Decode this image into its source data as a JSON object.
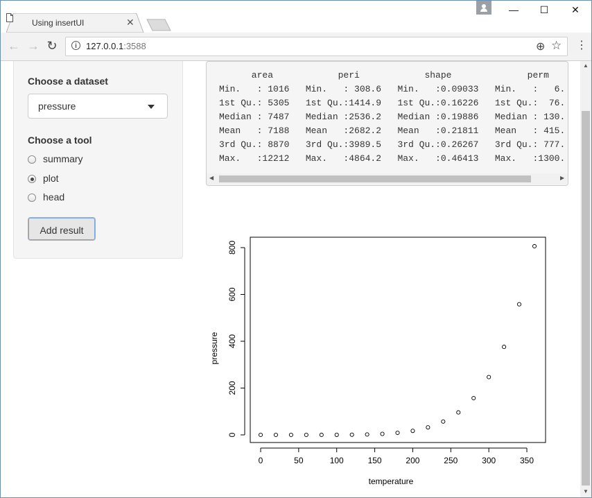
{
  "browser": {
    "tab_title": "Using insertUI",
    "url_host": "127.0.0.1",
    "url_port": ":3588"
  },
  "sidebar": {
    "dataset_label": "Choose a dataset",
    "dataset_value": "pressure",
    "tool_label": "Choose a tool",
    "tools": [
      {
        "label": "summary",
        "checked": false
      },
      {
        "label": "plot",
        "checked": true
      },
      {
        "label": "head",
        "checked": false
      }
    ],
    "add_button": "Add result"
  },
  "summary": {
    "lines": [
      "      area            peri            shape              perm",
      "Min.   : 1016   Min.   : 308.6   Min.   :0.09033   Min.   :   6.",
      "1st Qu.: 5305   1st Qu.:1414.9   1st Qu.:0.16226   1st Qu.:  76.",
      "Median : 7487   Median :2536.2   Median :0.19886   Median : 130.",
      "Mean   : 7188   Mean   :2682.2   Mean   :0.21811   Mean   : 415.",
      "3rd Qu.: 8870   3rd Qu.:3989.5   3rd Qu.:0.26267   3rd Qu.: 777.",
      "Max.   :12212   Max.   :4864.2   Max.   :0.46413   Max.   :1300."
    ]
  },
  "chart_data": {
    "type": "scatter",
    "title": "",
    "xlabel": "temperature",
    "ylabel": "pressure",
    "xlim": [
      0,
      360
    ],
    "ylim": [
      0,
      806
    ],
    "xticks": [
      0,
      50,
      100,
      150,
      200,
      250,
      300,
      350
    ],
    "yticks": [
      0,
      200,
      400,
      600,
      800
    ],
    "x": [
      0,
      20,
      40,
      60,
      80,
      100,
      120,
      140,
      160,
      180,
      200,
      220,
      240,
      260,
      280,
      300,
      320,
      340,
      360
    ],
    "y": [
      0.0002,
      0.0012,
      0.006,
      0.03,
      0.09,
      0.27,
      0.75,
      1.85,
      4.2,
      8.8,
      17.3,
      32.1,
      57,
      96,
      157,
      247,
      376,
      558,
      806
    ],
    "marker": "open-circle",
    "grid": false,
    "legend": "none"
  }
}
